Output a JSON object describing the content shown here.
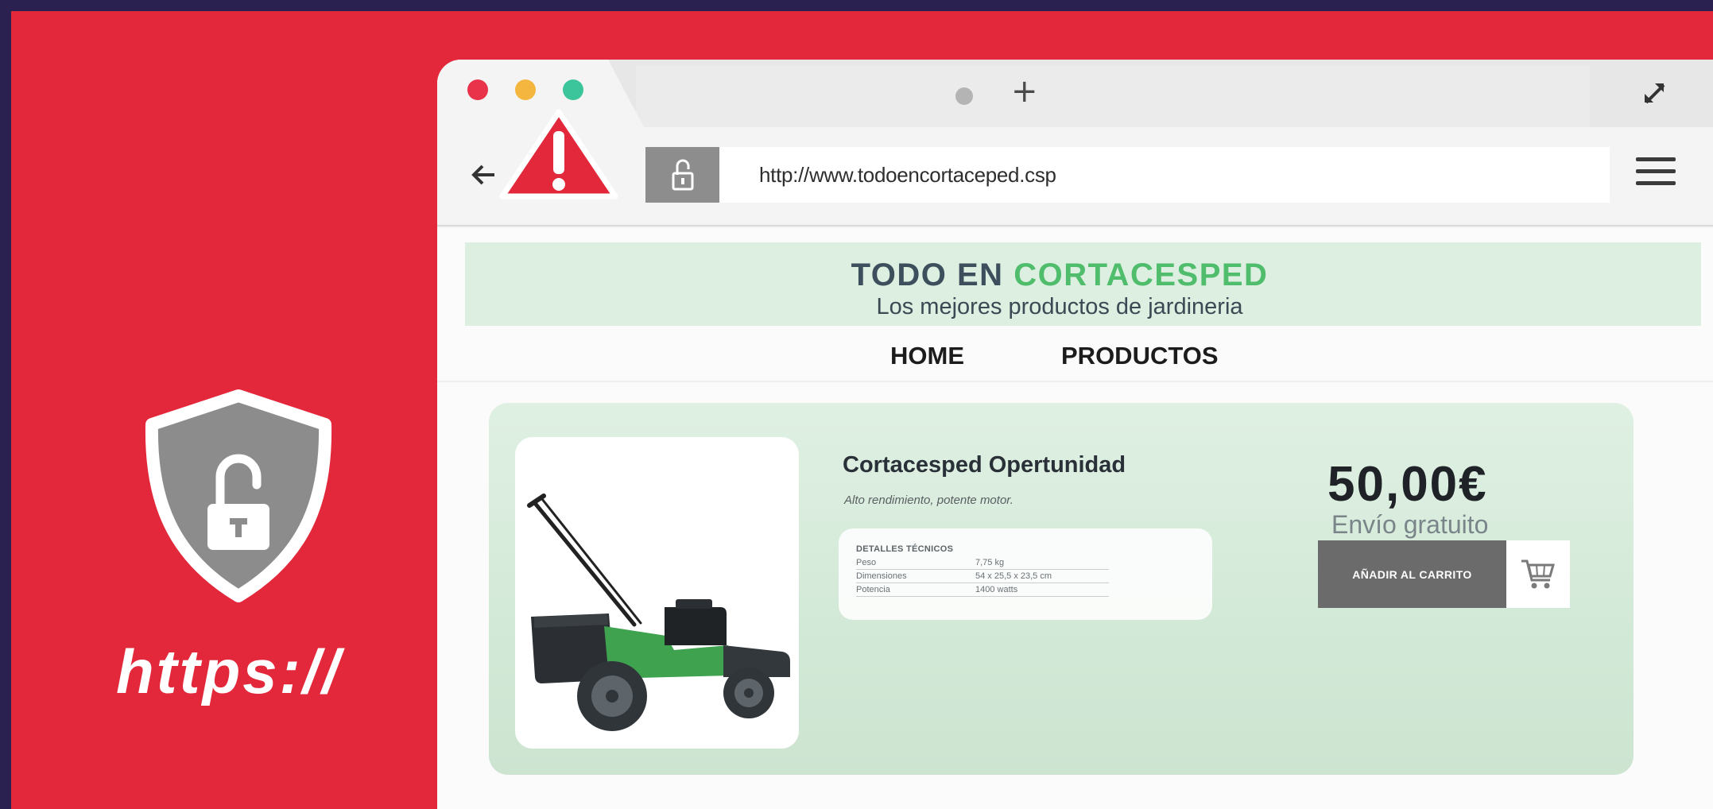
{
  "left_panel": {
    "protocol_text": "https://"
  },
  "browser": {
    "url": "http://www.todoencortaceped.csp"
  },
  "site": {
    "brand_part1": "TODO EN",
    "brand_part2": "CORTACESPED",
    "tagline": "Los mejores productos de jardineria",
    "nav": [
      {
        "label": "HOME"
      },
      {
        "label": "PRODUCTOS"
      }
    ],
    "product": {
      "name": "Cortacesped Opertunidad",
      "description": "Alto rendimiento, potente motor.",
      "details_title": "DETALLES TÉCNICOS",
      "details": [
        {
          "label": "Peso",
          "value": "7,75 kg"
        },
        {
          "label": "Dimensiones",
          "value": "54 x 25,5 x 23,5 cm"
        },
        {
          "label": "Potencia",
          "value": "1400 watts"
        }
      ],
      "price": "50,00€",
      "shipping": "Envío gratuito",
      "add_to_cart": "AÑADIR AL CARRITO"
    }
  },
  "icons": {
    "shield": "shield-unlocked-icon",
    "warning": "warning-triangle-icon",
    "lock": "unlocked-padlock-icon",
    "back": "back-arrow-icon",
    "menu": "hamburger-menu-icon",
    "new_tab": "plus-icon",
    "expand": "expand-icon",
    "cart": "shopping-cart-icon",
    "product_image": "lawnmower-image"
  },
  "colors": {
    "background_red": "#e2283a",
    "frame_navy": "#2b2150",
    "brand_dark": "#3d4f5c",
    "brand_green": "#4fbd6c",
    "banner_mint": "#dcefe1",
    "button_gray": "#6b6b6b"
  }
}
